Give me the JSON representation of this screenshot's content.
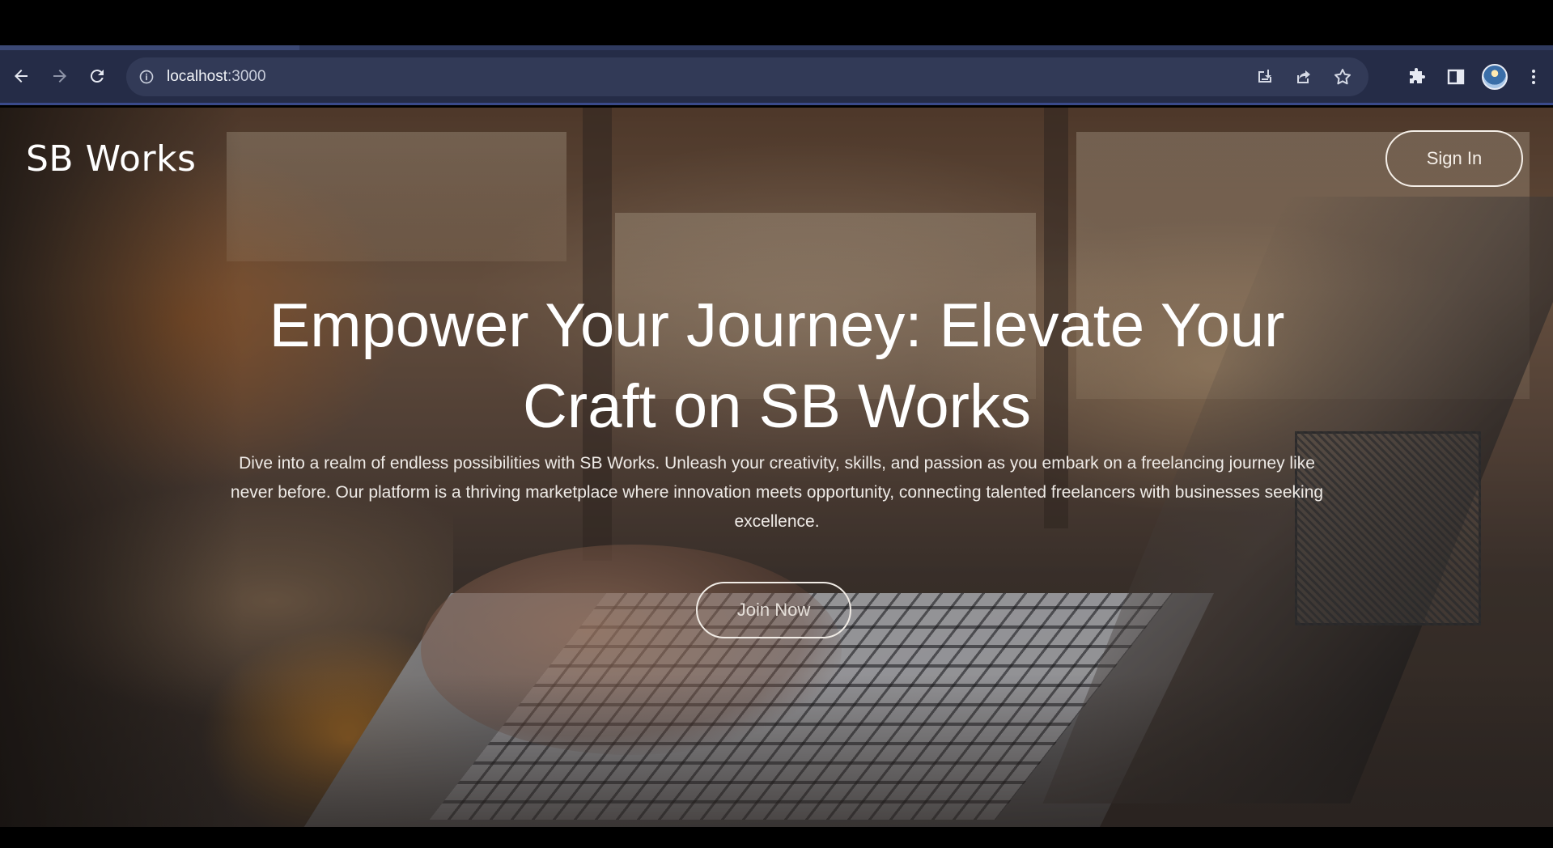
{
  "browser": {
    "url_host": "localhost",
    "url_port": ":3000",
    "icons": {
      "back": "arrow-left-icon",
      "forward": "arrow-right-icon",
      "reload": "reload-icon",
      "site_info": "info-icon",
      "install": "install-app-icon",
      "share": "share-icon",
      "bookmark": "star-icon",
      "extensions": "puzzle-icon",
      "side_panel": "side-panel-icon",
      "profile": "avatar",
      "menu": "kebab-menu-icon"
    }
  },
  "page": {
    "brand": "SB Works",
    "sign_in_label": "Sign In",
    "headline": "Empower Your Journey: Elevate Your Craft on SB Works",
    "description": "Dive into a realm of endless possibilities with SB Works. Unleash your creativity, skills, and passion as you embark on a freelancing journey like never before. Our platform is a thriving marketplace where innovation meets opportunity, connecting talented freelancers with businesses seeking excellence.",
    "join_label": "Join Now"
  },
  "colors": {
    "toolbar_bg": "#252c47",
    "omnibox_bg": "#323a57",
    "hero_text": "#ffffff"
  }
}
